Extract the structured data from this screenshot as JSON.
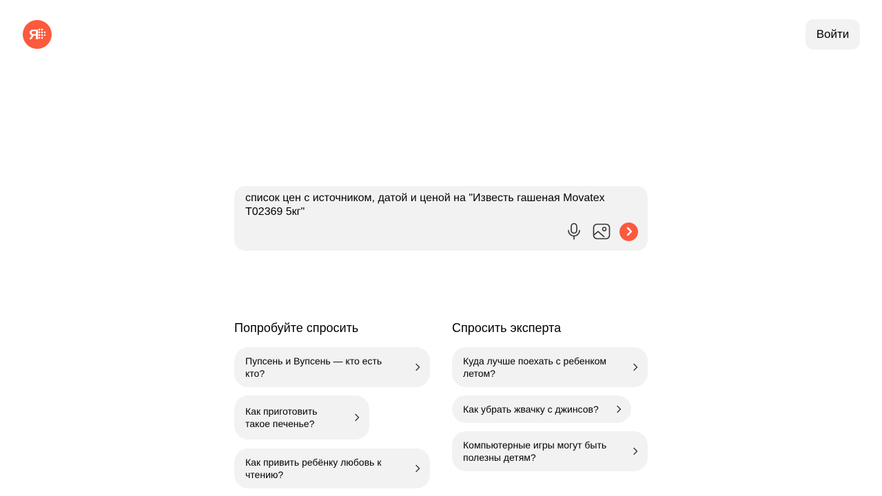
{
  "header": {
    "logo_icon": "yandex-alice-logo-icon",
    "login_label": "Войти",
    "accent_color": "#fc5a3c"
  },
  "query": {
    "text": "список цен с источником, датой и ценой на \"Известь гашеная Movatex Т02369 5кг\"",
    "icons": [
      "microphone-icon",
      "image-search-icon",
      "send-arrow-icon"
    ]
  },
  "try_ask": {
    "title": "Попробуйте спросить",
    "items": [
      {
        "label": "Пупсень и Вупсень — кто есть кто?"
      },
      {
        "label": "Как приготовить такое печенье?"
      },
      {
        "label": "Как привить ребёнку любовь к чтению?"
      }
    ]
  },
  "ask_expert": {
    "title": "Спросить эксперта",
    "items": [
      {
        "label": "Куда лучше поехать с ребенком летом?"
      },
      {
        "label": "Как убрать жвачку с джинсов?"
      },
      {
        "label": "Компьютерные игры могут быть полезны детям?"
      }
    ]
  }
}
